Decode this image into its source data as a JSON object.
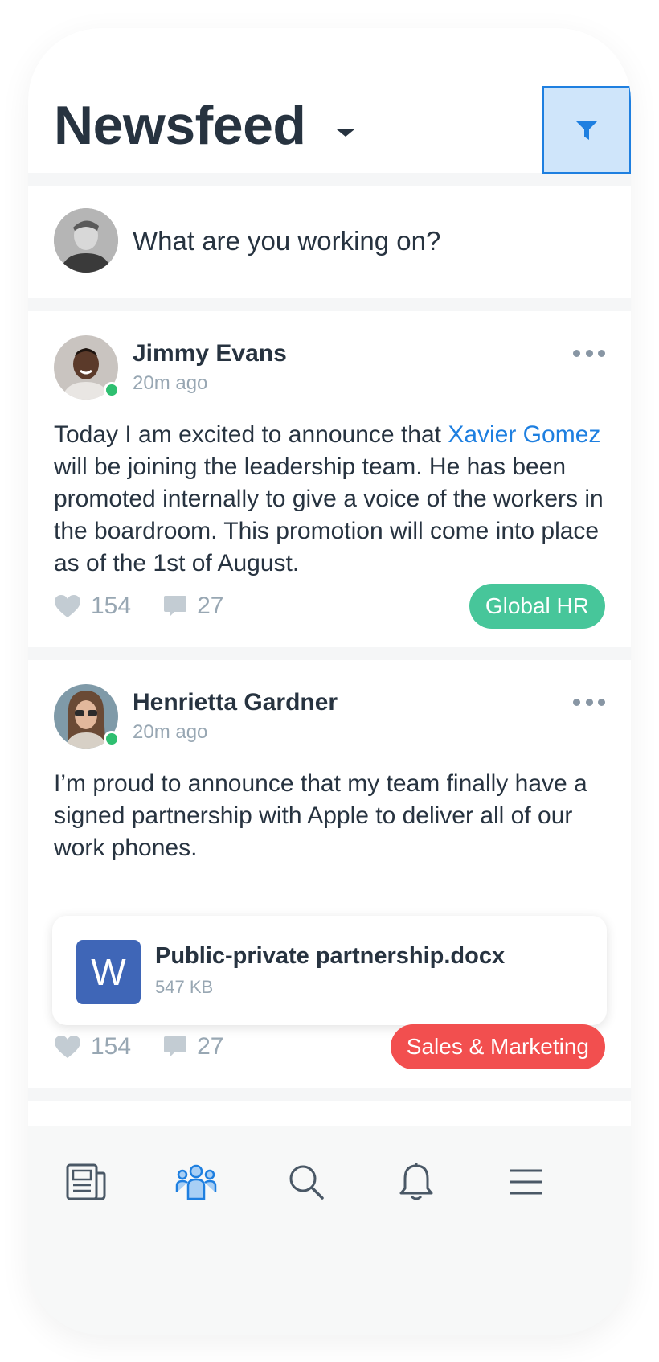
{
  "header": {
    "title": "Newsfeed",
    "dropdown_icon": "caret-down-icon",
    "filter_icon": "filter-icon"
  },
  "composer": {
    "placeholder": "What are you working on?"
  },
  "posts": [
    {
      "author": "Jimmy Evans",
      "time": "20m ago",
      "online": true,
      "body_before": "Today I am excited to announce that ",
      "mention": "Xavier Gomez",
      "body_after": " will be joining the leadership team. He has been promoted internally to give a voice of the workers in the boardroom. This promotion will come into place as of the 1st of August.",
      "likes": "154",
      "comments": "27",
      "tag": "Global HR",
      "tag_color": "#47c69a"
    },
    {
      "author": "Henrietta Gardner",
      "time": "20m ago",
      "online": true,
      "body": "I’m proud to announce that my team finally have a signed partnership with Apple to deliver all of our work phones.",
      "attachment": {
        "icon_letter": "W",
        "name": "Public-private partnership.docx",
        "size": "547 KB"
      },
      "likes": "154",
      "comments": "27",
      "tag": "Sales & Marketing",
      "tag_color": "#f24f4f"
    }
  ],
  "nav": {
    "items": [
      "newsfeed-icon",
      "people-icon",
      "search-icon",
      "bell-icon",
      "menu-icon"
    ],
    "active": "people-icon",
    "active_color": "#1e7fe0",
    "inactive_color": "#4a5866"
  },
  "colors": {
    "accent": "#1e7fe0",
    "online": "#2ebf70",
    "text": "#273340",
    "muted": "#98a7b3"
  }
}
